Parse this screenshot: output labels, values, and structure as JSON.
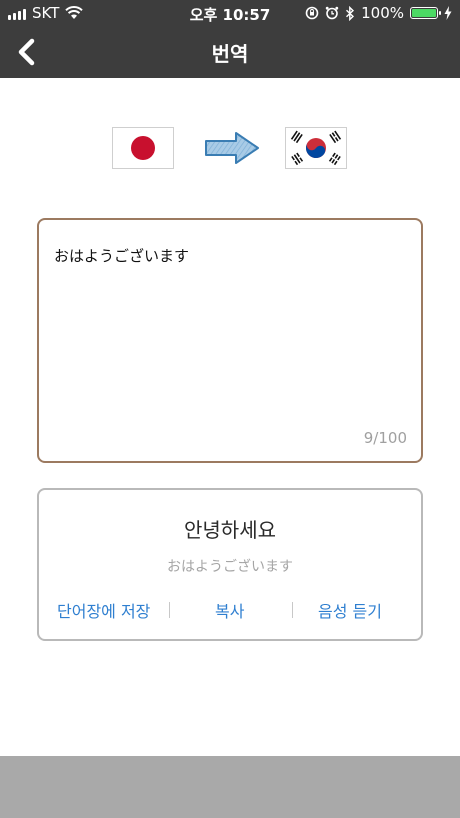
{
  "status_bar": {
    "carrier": "SKT",
    "time": "오후 10:57",
    "battery": "100%",
    "battery_level": 1.0,
    "icons": [
      "signal-icon",
      "wifi-icon",
      "orientation-lock-icon",
      "alarm-icon",
      "bluetooth-icon",
      "battery-icon",
      "charging-icon"
    ]
  },
  "nav": {
    "title": "번역",
    "back_icon": "chevron-left-icon"
  },
  "languages": {
    "source_flag": "japan-flag-icon",
    "arrow_icon": "arrow-right-icon",
    "target_flag": "korea-flag-icon"
  },
  "input": {
    "text": "おはようございます",
    "counter": "9/100"
  },
  "result": {
    "translation": "안녕하세요",
    "original": "おはようございます",
    "actions": {
      "save": "단어장에 저장",
      "copy": "복사",
      "listen": "음성 듣기"
    }
  },
  "colors": {
    "topbar": "#3d3d3d",
    "input_border": "#9c7a60",
    "action_blue": "#2f7fd0",
    "bottom_bar": "#a9a9a9"
  }
}
